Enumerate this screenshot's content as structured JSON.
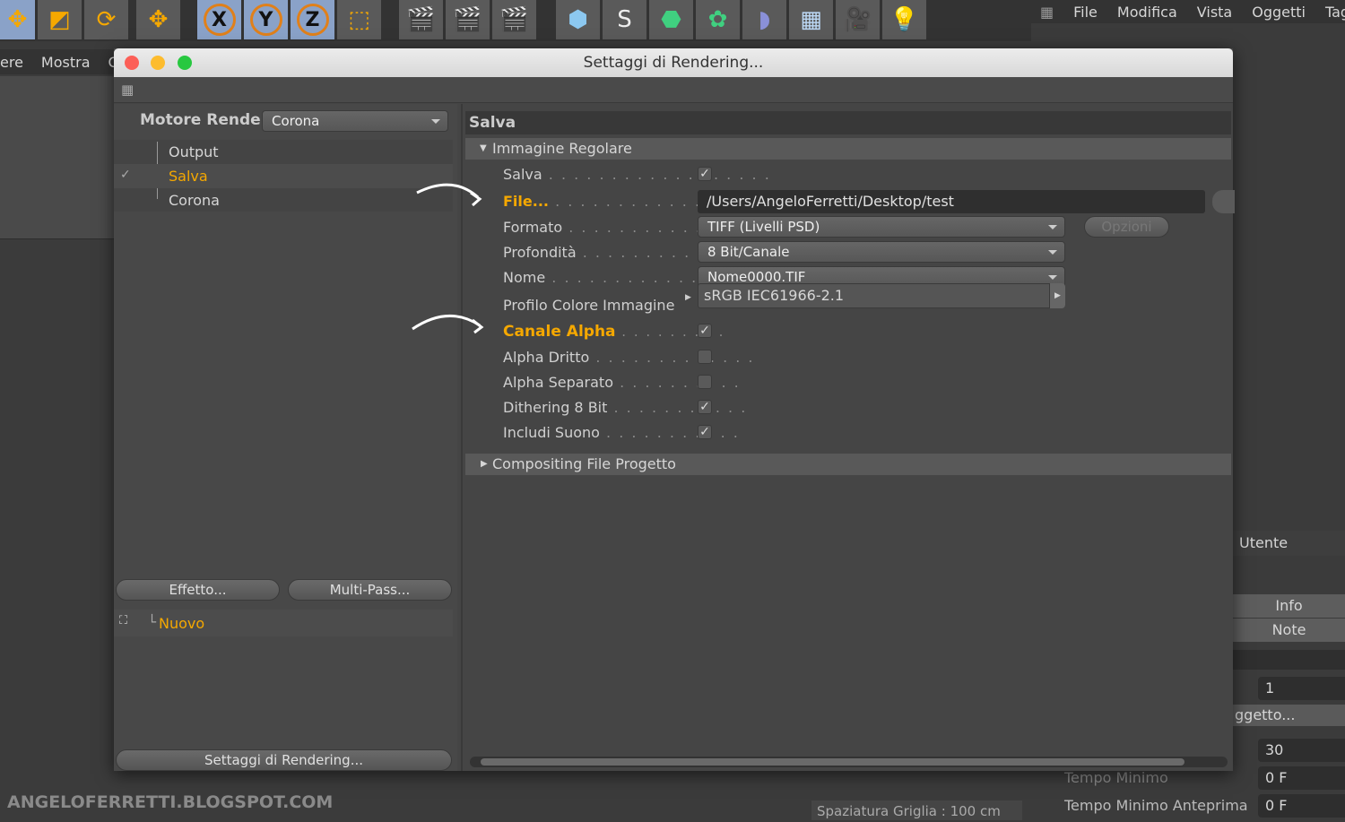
{
  "app": {
    "top_menu": [
      "File",
      "Modifica",
      "Vista",
      "Oggetti",
      "Tag"
    ],
    "left_menu": [
      "ere",
      "Mostra",
      "C"
    ]
  },
  "toolbar": {
    "icons": [
      "move-icon",
      "scale-icon",
      "rotate-icon",
      "live-selection-icon",
      "x-axis-icon",
      "y-axis-icon",
      "z-axis-icon",
      "coordinate-system-icon",
      "render-view-icon",
      "render-picture-viewer-icon",
      "render-settings-icon",
      "cube-icon",
      "spline-pen-icon",
      "subdivision-icon",
      "array-icon",
      "deformer-icon",
      "floor-icon",
      "camera-icon",
      "light-icon"
    ],
    "axis_labels": [
      "X",
      "Y",
      "Z"
    ]
  },
  "dialog": {
    "title": "Settaggi di Rendering...",
    "renderer_label": "Motore Render",
    "renderer_value": "Corona",
    "tree": [
      "Output",
      "Salva",
      "Corona"
    ],
    "effect_button": "Effetto...",
    "multipass_button": "Multi-Pass...",
    "new_item": "Nuovo",
    "render_settings_button": "Settaggi di Rendering...",
    "section_title": "Salva",
    "group_open": "Immagine Regolare",
    "group_closed": "Compositing File Progetto",
    "fields": {
      "salva": {
        "label": "Salva",
        "checked": true
      },
      "file": {
        "label": "File...",
        "value": "/Users/AngeloFerretti/Desktop/test"
      },
      "formato": {
        "label": "Formato",
        "value": "TIFF (Livelli PSD)",
        "button": "Opzioni"
      },
      "profondita": {
        "label": "Profondità",
        "value": "8 Bit/Canale"
      },
      "nome": {
        "label": "Nome",
        "value": "Nome0000.TIF"
      },
      "profilo": {
        "label": "Profilo Colore Immagine",
        "value": "sRGB IEC61966-2.1"
      },
      "canale_alpha": {
        "label": "Canale Alpha",
        "checked": true
      },
      "alpha_dritto": {
        "label": "Alpha Dritto",
        "checked": false
      },
      "alpha_separato": {
        "label": "Alpha Separato",
        "checked": false
      },
      "dithering": {
        "label": "Dithering 8 Bit",
        "checked": true
      },
      "suono": {
        "label": "Includi Suono",
        "checked": true
      }
    }
  },
  "right_panel": {
    "utente": "Utente",
    "info": "Info",
    "note": "Note",
    "value1": "1",
    "oggetto": "ggetto...",
    "value30": "30",
    "tempo_minimo": "Tempo Minimo",
    "tempo_minimo_val": "0 F",
    "tempo_anteprima": "Tempo Minimo Anteprima",
    "tempo_anteprima_val": "0 F"
  },
  "status": {
    "grid": "Spaziatura Griglia : 100 cm"
  },
  "watermark": "ANGELOFERRETTI.BLOGSPOT.COM",
  "colors": {
    "accent": "#f5a800",
    "panel": "#454545"
  }
}
